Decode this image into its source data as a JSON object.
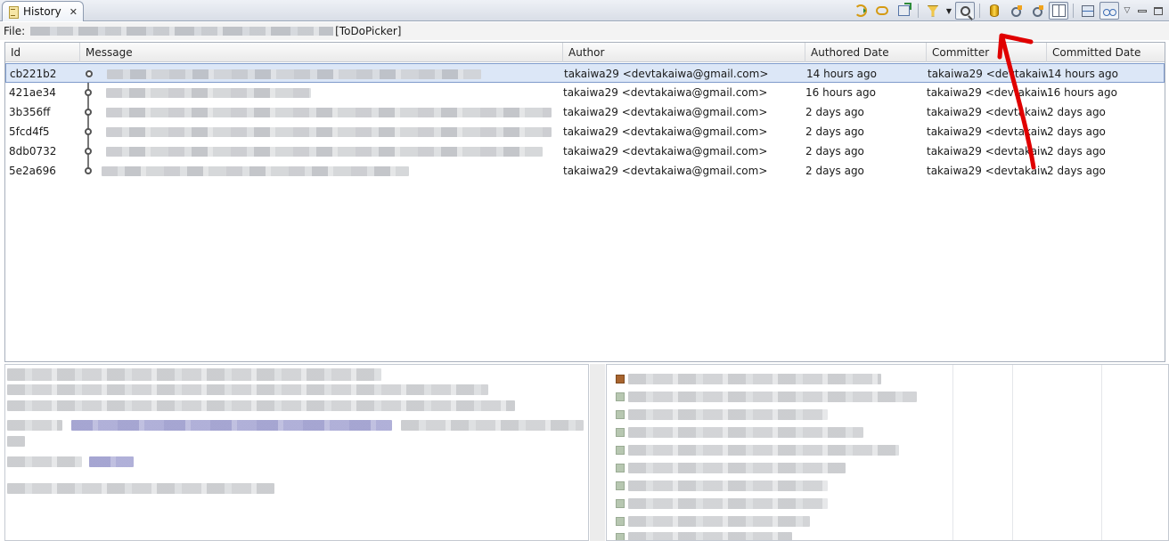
{
  "tab": {
    "title": "History"
  },
  "file": {
    "label": "File:",
    "project": "[ToDoPicker]"
  },
  "columns": [
    "Id",
    "Message",
    "Author",
    "Authored Date",
    "Committer",
    "Committed Date"
  ],
  "rows": [
    {
      "id": "cb221b2",
      "author": "takaiwa29 <devtakaiwa@gmail.com>",
      "authored": "14 hours ago",
      "committer": "takaiwa29 <devtakaiw",
      "committed": "14 hours ago",
      "msg_width": 420
    },
    {
      "id": "421ae34",
      "author": "takaiwa29 <devtakaiwa@gmail.com>",
      "authored": "16 hours ago",
      "committer": "takaiwa29 <devtakaiw",
      "committed": "16 hours ago",
      "msg_width": 230
    },
    {
      "id": "3b356ff",
      "author": "takaiwa29 <devtakaiwa@gmail.com>",
      "authored": "2 days ago",
      "committer": "takaiwa29 <devtakaiw",
      "committed": "2 days ago",
      "msg_width": 500
    },
    {
      "id": "5fcd4f5",
      "author": "takaiwa29 <devtakaiwa@gmail.com>",
      "authored": "2 days ago",
      "committer": "takaiwa29 <devtakaiw",
      "committed": "2 days ago",
      "msg_width": 500
    },
    {
      "id": "8db0732",
      "author": "takaiwa29 <devtakaiwa@gmail.com>",
      "authored": "2 days ago",
      "committer": "takaiwa29 <devtakaiw",
      "committed": "2 days ago",
      "msg_width": 490
    },
    {
      "id": "5e2a696",
      "author": "takaiwa29 <devtakaiwa@gmail.com>",
      "authored": "2 days ago",
      "committer": "takaiwa29 <devtakaiw",
      "committed": "2 days ago",
      "msg_width": 345
    }
  ],
  "toolbar": {
    "icons": [
      "sync-icon",
      "link-icon",
      "export-icon",
      "filter-icon",
      "filter-dropdown-icon",
      "search-icon",
      "repository-icon",
      "tag-icon",
      "branch-tag-icon",
      "compare-mode-icon",
      "layout-icon",
      "show-all-icon",
      "view-menu-icon",
      "minimize-icon",
      "maximize-icon"
    ]
  },
  "colors": {
    "selection": "#dce7f7",
    "annotation_arrow": "#e00000"
  }
}
